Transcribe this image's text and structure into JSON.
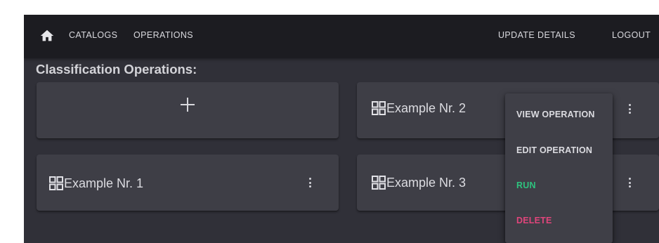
{
  "colors": {
    "topbar_bg": "#1c1c21",
    "page_bg": "#303038",
    "card_bg": "#3e3e46",
    "menu_bg": "#3f3f47",
    "text": "#dcdce1",
    "run": "#2ec27e",
    "delete": "#e0457b"
  },
  "nav": {
    "home_icon": "home-icon",
    "catalogs": "CATALOGS",
    "operations": "OPERATIONS",
    "update_details": "UPDATE DETAILS",
    "logout": "LOGOUT"
  },
  "page": {
    "heading": "Classification Operations:"
  },
  "add_card": {
    "icon": "plus-icon"
  },
  "cards": [
    {
      "title": "Example Nr. 1",
      "icon": "grid-icon"
    },
    {
      "title": "Example Nr. 2",
      "icon": "grid-icon"
    },
    {
      "title": "Example Nr. 3",
      "icon": "grid-icon"
    }
  ],
  "context_menu": {
    "items": [
      {
        "label": "VIEW OPERATION",
        "color": "#dcdce1"
      },
      {
        "label": "EDIT OPERATION",
        "color": "#dcdce1"
      },
      {
        "label": "RUN",
        "color": "#2ec27e"
      },
      {
        "label": "DELETE",
        "color": "#e0457b"
      }
    ]
  }
}
